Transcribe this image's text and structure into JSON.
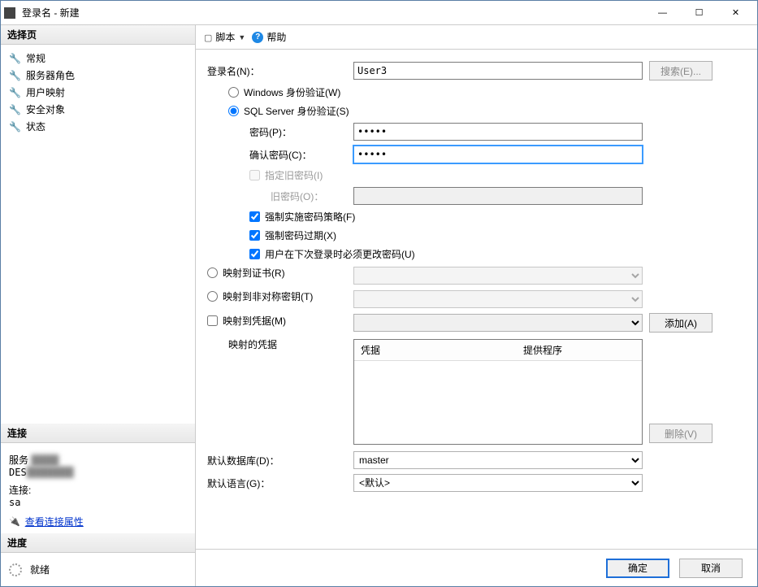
{
  "title": "登录名 - 新建",
  "sidebar": {
    "select_page": "选择页",
    "items": [
      "常规",
      "服务器角色",
      "用户映射",
      "安全对象",
      "状态"
    ],
    "connection": {
      "header": "连接",
      "server_label": "服务",
      "server_value": "DES",
      "conn_label": "连接:",
      "conn_value": "sa",
      "view_props": "查看连接属性"
    },
    "progress": {
      "header": "进度",
      "status": "就绪"
    }
  },
  "toolbar": {
    "script": "脚本",
    "help": "帮助"
  },
  "form": {
    "login_name_label": "登录名(N)：",
    "login_name_value": "User3",
    "search_btn": "搜索(E)...",
    "auth_windows": "Windows 身份验证(W)",
    "auth_sql": "SQL Server 身份验证(S)",
    "password_label": "密码(P)：",
    "password_value": "•••••",
    "confirm_label": "确认密码(C)：",
    "confirm_value": "•••••",
    "specify_old": "指定旧密码(I)",
    "old_pwd_label": "旧密码(O)：",
    "enforce_policy": "强制实施密码策略(F)",
    "enforce_expire": "强制密码过期(X)",
    "must_change": "用户在下次登录时必须更改密码(U)",
    "map_cert": "映射到证书(R)",
    "map_asym": "映射到非对称密钥(T)",
    "map_cred": "映射到凭据(M)",
    "add_btn": "添加(A)",
    "mapped_creds": "映射的凭据",
    "th_cred": "凭据",
    "th_provider": "提供程序",
    "remove_btn": "删除(V)",
    "default_db_label": "默认数据库(D)：",
    "default_db_value": "master",
    "default_lang_label": "默认语言(G)：",
    "default_lang_value": "<默认>"
  },
  "footer": {
    "ok": "确定",
    "cancel": "取消"
  }
}
